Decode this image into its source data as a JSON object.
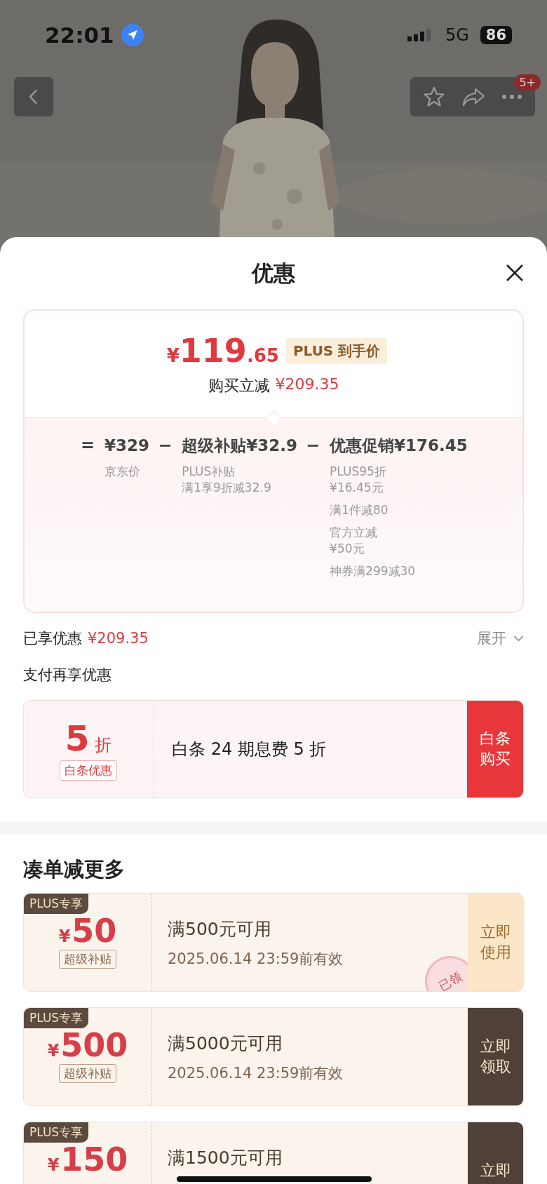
{
  "status_bar": {
    "time": "22:01",
    "network": "5G",
    "battery": "86"
  },
  "nav": {
    "badge": "5+"
  },
  "sheet": {
    "title": "优惠"
  },
  "price_card": {
    "currency": "¥",
    "price_int": "119",
    "price_dec": ".65",
    "price_tag": "PLUS 到手价",
    "saving_label": "购买立减",
    "saving_amount": "¥209.35",
    "breakdown": [
      {
        "operator": "=",
        "amount": "¥329",
        "notes": [
          [
            "京东价"
          ]
        ]
      },
      {
        "operator": "−",
        "label": "超级补贴",
        "amount": "¥32.9",
        "notes": [
          [
            "PLUS补贴",
            "满1享9折减32.9"
          ]
        ]
      },
      {
        "operator": "−",
        "label": "优惠促销",
        "amount": "¥176.45",
        "notes": [
          [
            "PLUS95折",
            "¥16.45元"
          ],
          [
            "满1件减80"
          ],
          [
            "官方立减",
            "¥50元"
          ],
          [
            "神券满299减30"
          ]
        ]
      }
    ]
  },
  "summary": {
    "label": "已享优惠",
    "amount": "¥209.35",
    "expand": "展开"
  },
  "pay_section": {
    "title": "支付再享优惠",
    "offer": {
      "value": "5",
      "unit": "折",
      "tag": "白条优惠",
      "description": "白条 24 期息费 5 折",
      "action": "白条购买"
    }
  },
  "coupons_section": {
    "title": "凑单减更多",
    "coupons": [
      {
        "kind": "use",
        "badge": "PLUS专享",
        "currency": "¥",
        "amount": "50",
        "tag": "超级补贴",
        "condition": "满500元可用",
        "validity": "2025.06.14 23:59前有效",
        "stamp": "已领",
        "action": "立即使用"
      },
      {
        "kind": "claim",
        "badge": "PLUS专享",
        "currency": "¥",
        "amount": "500",
        "tag": "超级补贴",
        "condition": "满5000元可用",
        "validity": "2025.06.14 23:59前有效",
        "action": "立即领取"
      },
      {
        "kind": "claim",
        "badge": "PLUS专享",
        "currency": "¥",
        "amount": "150",
        "condition": "满1500元可用",
        "action": "立即"
      }
    ]
  }
}
